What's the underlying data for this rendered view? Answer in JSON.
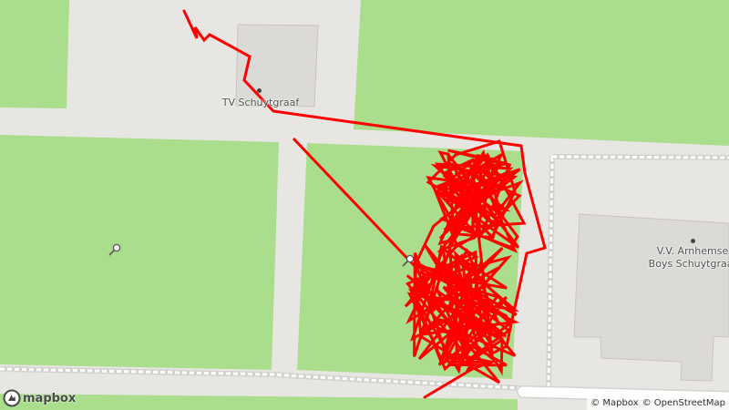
{
  "map": {
    "colors": {
      "background": "#e8e6e3",
      "grass": "#aade8d",
      "building": "#dcdad7",
      "building_stroke": "#c8c5c1",
      "road": "#ffffff",
      "path_dash": "#ffffff",
      "track": "#ff0000"
    },
    "labels": {
      "club_south": "TV Schuytgraaf",
      "club_east_line1": "V.V. Arnhemse",
      "club_east_line2": "Boys Schuytgraaf"
    },
    "icons": [
      "tennis-icon",
      "point-of-interest-icon"
    ]
  },
  "branding": {
    "logo_text": "mapbox"
  },
  "attribution": {
    "mapbox": "© Mapbox",
    "osm": "© OpenStreetMap"
  }
}
